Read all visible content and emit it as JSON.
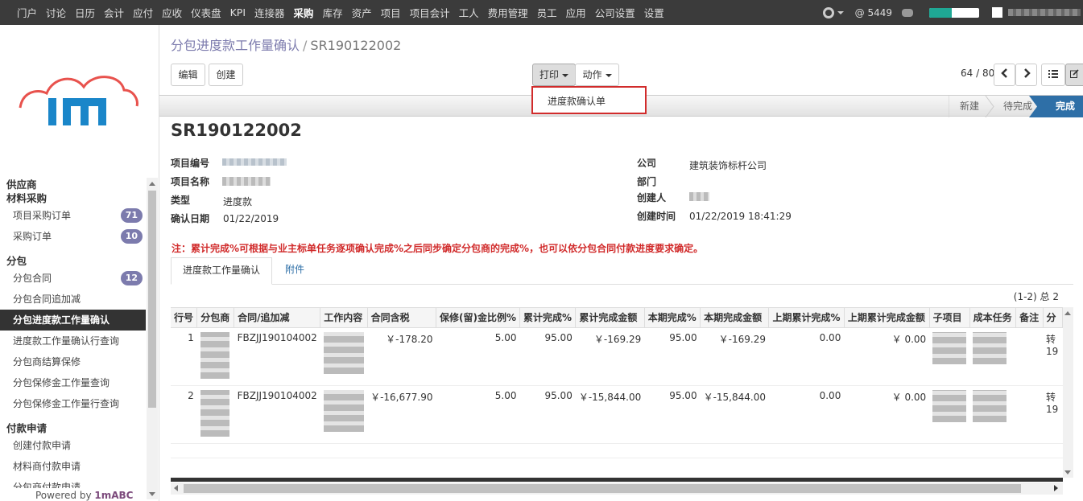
{
  "topmenu": [
    "门户",
    "讨论",
    "日历",
    "会计",
    "应付",
    "应收",
    "仪表盘",
    "KPI",
    "连接器",
    "采购",
    "库存",
    "资产",
    "项目",
    "项目会计",
    "工人",
    "费用管理",
    "员工",
    "应用",
    "公司设置",
    "设置"
  ],
  "topmenu_active": "采购",
  "topright": {
    "messages": "@ 5449",
    "progress": 0.45
  },
  "sidebar": {
    "sections": [
      "供应商",
      "材料采购",
      "分包",
      "付款申请"
    ],
    "items": [
      {
        "label": "项目采购订单",
        "badge": "71"
      },
      {
        "label": "采购订单",
        "badge": "10"
      },
      {
        "label": "分包合同",
        "badge": "12"
      },
      {
        "label": "分包合同追加减",
        "badge": ""
      },
      {
        "label": "分包进度款工作量确认",
        "badge": ""
      },
      {
        "label": "进度款工作量确认行查询",
        "badge": ""
      },
      {
        "label": "分包商结算保修",
        "badge": ""
      },
      {
        "label": "分包保修金工作量查询",
        "badge": ""
      },
      {
        "label": "分包保修金工作量行查询",
        "badge": ""
      },
      {
        "label": "创建付款申请",
        "badge": ""
      },
      {
        "label": "材料商付款申请",
        "badge": ""
      },
      {
        "label": "分包商付款申请",
        "badge": ""
      }
    ],
    "powered_prefix": "Powered by ",
    "powered_brand": "1mABC"
  },
  "breadcrumb": {
    "parent": "分包进度款工作量确认",
    "sep": "/",
    "current": "SR190122002"
  },
  "buttons": {
    "edit": "编辑",
    "create": "创建",
    "print": "打印",
    "action": "动作"
  },
  "pager": "64 / 80",
  "dropdown_item": "进度款确认单",
  "stages": [
    "新建",
    "待完成",
    "完成"
  ],
  "record_title": "SR190122002",
  "fields_left": [
    {
      "label": "项目编号",
      "value": ""
    },
    {
      "label": "项目名称",
      "value": ""
    },
    {
      "label": "类型",
      "value": "进度款"
    },
    {
      "label": "确认日期",
      "value": "01/22/2019"
    }
  ],
  "fields_right": [
    {
      "label": "公司",
      "value": "建筑装饰标杆公司"
    },
    {
      "label": "部门",
      "value": ""
    },
    {
      "label": "创建人",
      "value": ""
    },
    {
      "label": "创建时间",
      "value": "01/22/2019 18:41:29"
    }
  ],
  "note": "注：累计完成%可根据与业主标单任务逐项确认完成%之后同步确定分包商的完成%，也可以依分包合同付款进度要求确定。",
  "tabs": [
    "进度款工作量确认",
    "附件"
  ],
  "record_count": "(1-2) 总 2",
  "table": {
    "headers": [
      "行号",
      "分包商",
      "合同/追加减",
      "工作内容",
      "合同含税",
      "保修(留)金比例%",
      "累计完成%",
      "累计完成金额",
      "本期完成%",
      "本期完成金额",
      "上期累计完成%",
      "上期累计完成金额",
      "子项目",
      "成本任务",
      "备注",
      "分"
    ],
    "rows": [
      {
        "no": "1",
        "contract": "FBZJJ190104002",
        "tax": "￥-178.20",
        "ratio": "5.00",
        "cum": "95.00",
        "cumamt": "￥-169.29",
        "cur": "95.00",
        "curamt": "￥-169.29",
        "prev": "0.00",
        "prevamt": "￥ 0.00",
        "last": "转",
        "last2": "19"
      },
      {
        "no": "2",
        "contract": "FBZJJ190104002",
        "tax": "￥-16,677.90",
        "ratio": "5.00",
        "cum": "95.00",
        "cumamt": "￥-15,844.00",
        "cur": "95.00",
        "curamt": "￥-15,844.00",
        "prev": "0.00",
        "prevamt": "￥ 0.00",
        "last": "转",
        "last2": "19"
      }
    ]
  },
  "colors": {
    "topbar": "#3b3b3b",
    "accent": "#7c7bad",
    "stage_done": "#2e6fa7",
    "note": "#d12b2b"
  }
}
